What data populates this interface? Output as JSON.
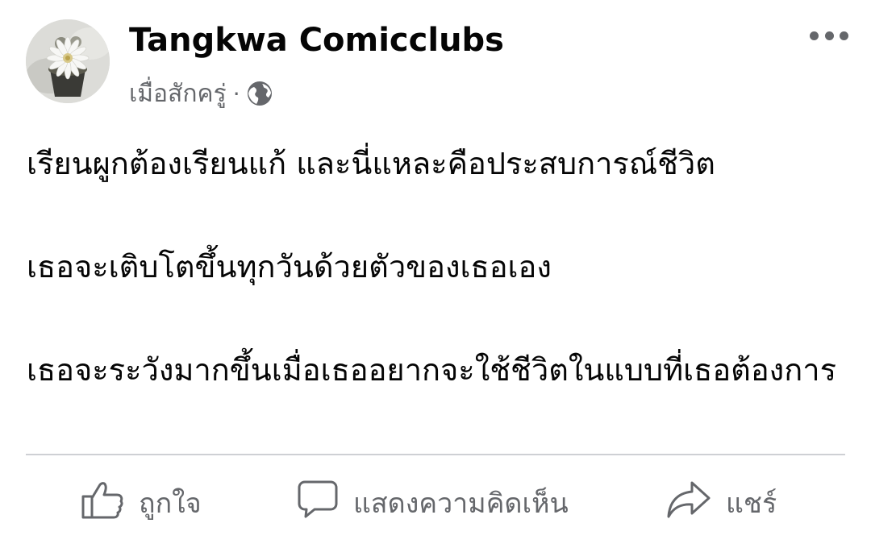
{
  "post": {
    "page_name": "Tangkwa Comicclubs",
    "timestamp": "เมื่อสักครู่",
    "separator": "·",
    "privacy_icon": "globe-icon",
    "more_icon": "more-options-icon",
    "avatar_icon": "flower-avatar",
    "paragraphs": [
      "เรียนผูกต้องเรียนแก้ และนี่แหละคือประสบการณ์ชีวิต",
      "เธอจะเติบโตขึ้นทุกวันด้วยตัวของเธอเอง",
      "เธอจะระวังมากขึ้นเมื่อเธออยากจะใช้ชีวิตในแบบที่เธอต้องการ"
    ]
  },
  "actions": {
    "like_label": "ถูกใจ",
    "comment_label": "แสดงความคิดเห็น",
    "share_label": "แชร์",
    "like_icon": "thumbs-up-icon",
    "comment_icon": "comment-bubble-icon",
    "share_icon": "share-arrow-icon"
  },
  "colors": {
    "text_primary": "#050505",
    "text_secondary": "#65676b",
    "divider": "#ced0d4",
    "background": "#ffffff"
  }
}
